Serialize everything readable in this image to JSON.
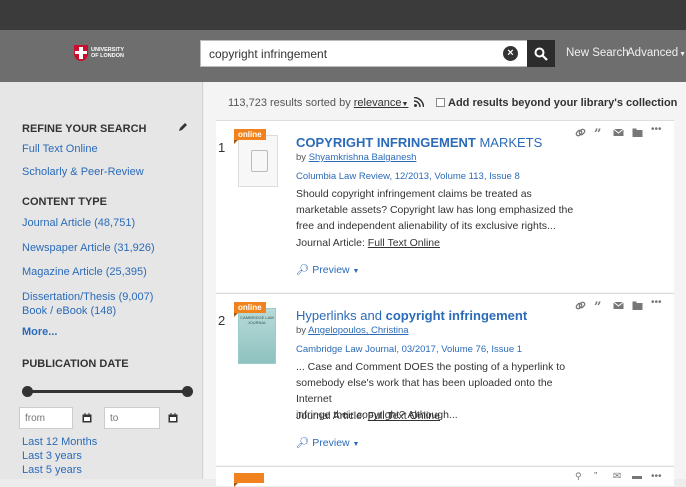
{
  "header": {
    "logo_line1": "University",
    "logo_line2": "of London",
    "search_value": "copyright infringement",
    "new_search": "New Search",
    "advanced": "Advanced"
  },
  "sidebar": {
    "refine_heading": "REFINE YOUR SEARCH",
    "full_text": "Full Text Online",
    "scholarly": "Scholarly & Peer-Review",
    "content_type_heading": "CONTENT TYPE",
    "content_types": [
      "Journal Article (48,751)",
      "Newspaper Article (31,926)",
      "Magazine Article (25,395)",
      "Dissertation/Thesis (9,007)",
      "Book / eBook (148)"
    ],
    "more": "More...",
    "pub_date_heading": "PUBLICATION DATE",
    "from_placeholder": "from",
    "to_placeholder": "to",
    "date_ranges": [
      "Last 12 Months",
      "Last 3 years",
      "Last 5 years"
    ]
  },
  "main": {
    "result_count": "113,723 results sorted by",
    "sort_value": "relevance",
    "beyond_label": "Add results beyond your library's collection",
    "results": [
      {
        "number": "1",
        "badge": "online",
        "title_bold": "COPYRIGHT INFRINGEMENT",
        "title_rest": " MARKETS",
        "by": "by",
        "author": "Shyamkrishna Balganesh",
        "source": "Columbia Law Review, 12/2013, Volume 113, Issue 8",
        "snippet_lines": [
          "Should copyright infringement claims be treated as",
          "marketable assets? Copyright law has long emphasized the",
          "free and independent alienability of its exclusive rights..."
        ],
        "format_label": "Journal Article:",
        "format_link": "Full Text Online",
        "preview": "Preview"
      },
      {
        "number": "2",
        "badge": "online",
        "cover_title": "CAMBRIDGE LAW JOURNAL",
        "title_pre": "Hyperlinks and ",
        "title_bold": "copyright infringement",
        "by": "by",
        "author": "Angelopoulos, Christina",
        "source": "Cambridge Law Journal, 03/2017, Volume 76, Issue 1",
        "snippet_lines": [
          "... Case and Comment DOES the posting of a hyperlink to",
          "somebody else's work that has been uploaded onto the Internet",
          "infringe their copyright? Although..."
        ],
        "format_label": "Journal Article:",
        "format_link": "Full Text Online",
        "preview": "Preview"
      }
    ]
  }
}
